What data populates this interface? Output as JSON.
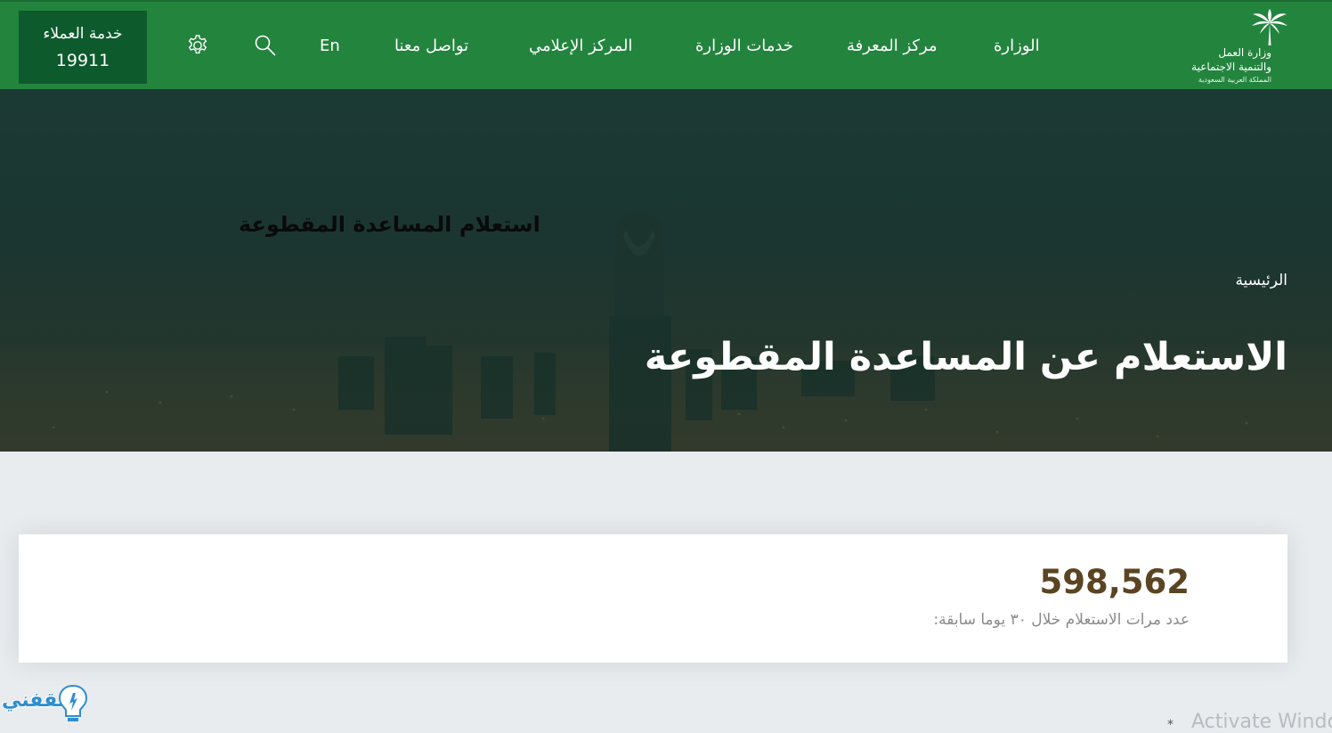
{
  "header": {
    "customer_service_label": "خدمة العملاء",
    "customer_service_number": "19911",
    "language_toggle": "En",
    "nav": {
      "contact": "تواصل معنا",
      "media": "المركز الإعلامي",
      "services": "خدمات الوزارة",
      "knowledge": "مركز المعرفة",
      "ministry": "الوزارة"
    },
    "logo": {
      "line1": "وزارة العمل",
      "line2": "والتنمية الاجتماعية",
      "line3": "المملكة العربية السعودية"
    },
    "colors": {
      "background": "#23843e",
      "service_box": "#0d5a2c"
    }
  },
  "hero": {
    "page_heading": "استعلام المساعدة المقطوعة",
    "breadcrumb": "الرئيسية",
    "title": "الاستعلام عن المساعدة المقطوعة"
  },
  "stats": {
    "value": "598,562",
    "label": "عدد مرات الاستعلام خلال ٣٠ يوما سابقة:",
    "value_color": "#5a4422"
  },
  "overlay": {
    "watermark": "ثقفني",
    "activate_text": "Activate Windo",
    "asterisk": "*"
  },
  "icons": {
    "settings": "gear-icon",
    "search": "search-icon",
    "logo": "palm-tree-icon"
  }
}
